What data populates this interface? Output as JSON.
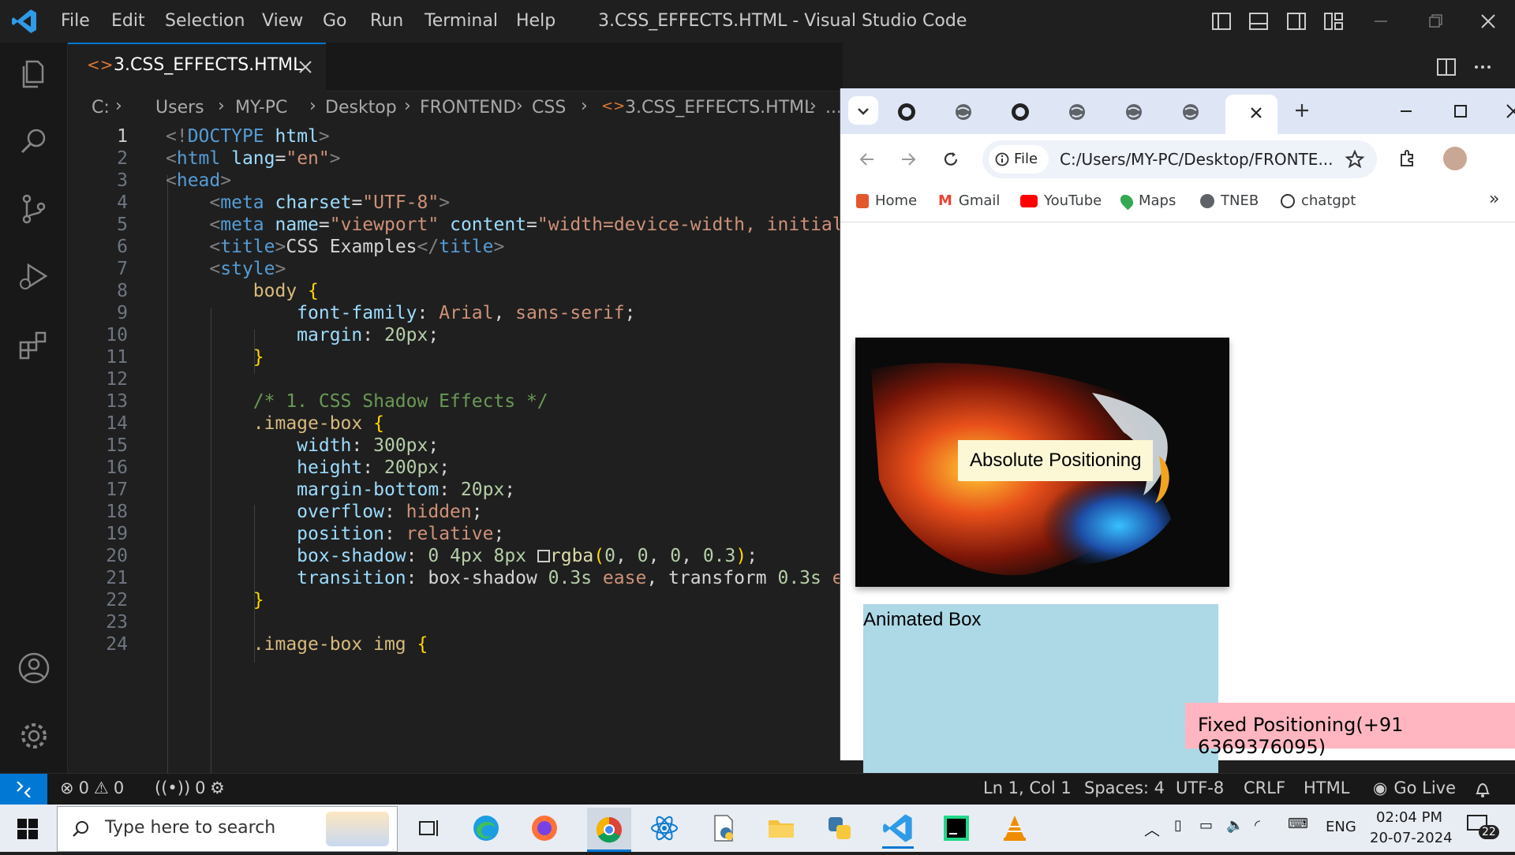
{
  "menu": [
    "File",
    "Edit",
    "Selection",
    "View",
    "Go",
    "Run",
    "Terminal",
    "Help"
  ],
  "window_title": "3.CSS_EFFECTS.HTML - Visual Studio Code",
  "editor": {
    "tab_label": "3.CSS_EFFECTS.HTML",
    "breadcrumbs": [
      "C:",
      "Users",
      "MY-PC",
      "Desktop",
      "FRONTEND",
      "CSS",
      "3.CSS_EFFECTS.HTML",
      "..."
    ],
    "line_numbers": [
      "1",
      "2",
      "3",
      "4",
      "5",
      "6",
      "7",
      "8",
      "9",
      "10",
      "11",
      "12",
      "13",
      "14",
      "15",
      "16",
      "17",
      "18",
      "19",
      "20",
      "21",
      "22",
      "23",
      "24"
    ]
  },
  "status": {
    "errors": "0",
    "warnings": "0",
    "ports": "0",
    "cursor": "Ln 1, Col 1",
    "spaces": "Spaces: 4",
    "encoding": "UTF-8",
    "eol": "CRLF",
    "language": "HTML",
    "golive": "Go Live"
  },
  "browser": {
    "address_chip": "File",
    "url": "C:/Users/MY-PC/Desktop/FRONTE...",
    "bookmarks": [
      "Home",
      "Gmail",
      "YouTube",
      "Maps",
      "TNEB",
      "chatgpt"
    ],
    "page": {
      "absolute_label": "Absolute Positioning",
      "animated_label": "Animated Box",
      "fixed_label": "Fixed Positioning(+91 6369376095)"
    }
  },
  "taskbar": {
    "search_placeholder": "Type here to search",
    "lang": "ENG",
    "time": "02:04 PM",
    "date": "20-07-2024",
    "notifications": "22"
  },
  "colors": {
    "accent": "#0078d4",
    "animated_box": "#add8e6",
    "fixed_box": "#ffb6c1",
    "absolute_box": "#fcf8d6"
  }
}
